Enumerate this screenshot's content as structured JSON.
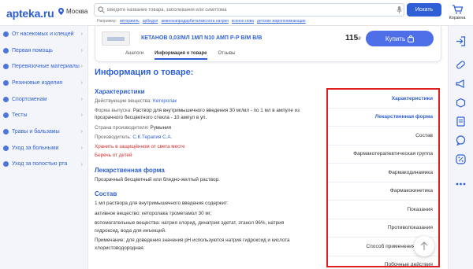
{
  "header": {
    "logo": "apteka.ru",
    "city": "Москва",
    "search": {
      "placeholder": "Введите название товара, заболевания или симптома"
    },
    "search_button": "Искать",
    "hints": {
      "label": "Например:",
      "items": [
        "веторжиль",
        "арбидол",
        "аминокапродарбиталкислота натрия",
        "ксенон нова",
        "детские жаропонижающие"
      ]
    },
    "cart_label": "Корзина"
  },
  "sidebar": {
    "items": [
      {
        "label": "От насекомых и клещей",
        "icon": "bug-icon"
      },
      {
        "label": "Первая помощь",
        "icon": "first-aid-icon"
      },
      {
        "label": "Перевязочные материалы",
        "icon": "bandage-icon"
      },
      {
        "label": "Резиновые изделия",
        "icon": "rubber-icon"
      },
      {
        "label": "Спортсменам",
        "icon": "sport-icon"
      },
      {
        "label": "Тесты",
        "icon": "test-icon"
      },
      {
        "label": "Травы и бальзамы",
        "icon": "herb-icon"
      },
      {
        "label": "Уход за больными",
        "icon": "care-icon"
      },
      {
        "label": "Уход за полостью рта",
        "icon": "tooth-icon"
      }
    ]
  },
  "product": {
    "name": "КЕТАНОВ 0,03/МЛ 1МЛ N10 АМП Р-Р В/М В/В",
    "price": "115",
    "currency": "₽",
    "buy_label": "Купить",
    "tabs": [
      "Аналоги",
      "Информация о товаре",
      "Отзывы"
    ]
  },
  "info": {
    "title": "Информация о товаре:",
    "characteristics": {
      "heading": "Характеристики",
      "substance_key": "Действующие вещества:",
      "substance_val": "Кеторолак",
      "form_key": "Форма выпуска:",
      "form_val": "Раствор для внутримышечного введения 30 мг/мл - по 1 мл в ампуле из",
      "form_val2": "прозрачного бесцветного стекла - 10 ампул в уп.",
      "country_key": "Страна производителя:",
      "country_val": "Румыния",
      "maker_key": "Производитель:",
      "maker_val": "С.К.Терапия С.А.",
      "warn1": "Хранить в защищённом от света месте",
      "warn2": "Беречь от детей"
    },
    "drug_form": {
      "heading": "Лекарственная форма",
      "text": "Прозрачный бесцветный или бледно-желтый раствор."
    },
    "composition": {
      "heading": "Состав",
      "l1": "1 мл раствора для внутримышечного введения содержит:",
      "l2": "активное вещество: кеторолака трометамол 30 мг;",
      "l3": "вспомогательные вещества: натрия хлорид, динатрия эдетат, этанол 96%, натрия",
      "l4": "гидроксид, вода для инъекций.",
      "l5": "Примечание: для доведения значения pH используются натрия гидроксид и кислота",
      "l6": "хлористоводородная."
    }
  },
  "toc": {
    "items": [
      "Характеристики",
      "Лекарственная форма",
      "Состав",
      "Фармакотерапевтическая группа",
      "Фармакодинамика",
      "Фармакокинетика",
      "Показания",
      "Противопоказания",
      "Способ применения и дозы",
      "Побочные действия"
    ]
  },
  "accent": "#2e5fd6",
  "highlight": "#e02020"
}
